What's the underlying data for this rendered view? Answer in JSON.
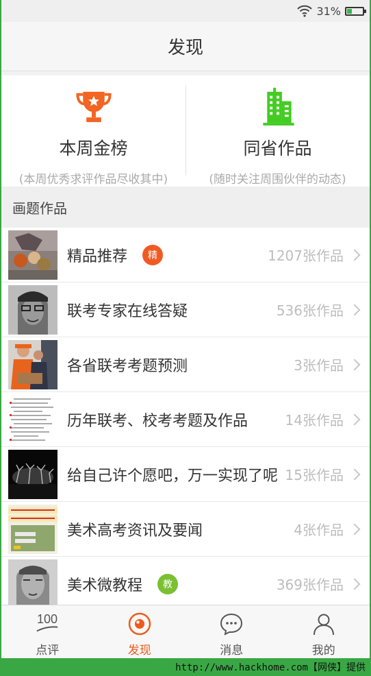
{
  "status_bar": {
    "battery_percent": "31%",
    "battery_level": 0.31,
    "wifi_icon": "wifi-icon"
  },
  "header": {
    "title": "发现"
  },
  "featured": [
    {
      "title": "本周金榜",
      "subtitle": "(本周优秀求评作品尽收其中)",
      "icon": "trophy-icon",
      "color": "#f26522"
    },
    {
      "title": "同省作品",
      "subtitle": "(随时关注周围伙伴的动态)",
      "icon": "buildings-icon",
      "color": "#44cc22"
    }
  ],
  "section": {
    "title": "画题作品"
  },
  "items": [
    {
      "label": "精品推荐",
      "badge": "精",
      "badge_color": "#f05a22",
      "count": "1207张作品"
    },
    {
      "label": "联考专家在线答疑",
      "count": "536张作品"
    },
    {
      "label": "各省联考考题预测",
      "count": "3张作品"
    },
    {
      "label": "历年联考、校考考题及作品",
      "count": "14张作品"
    },
    {
      "label": "给自己许个愿吧，万一实现了呢",
      "count": "15张作品"
    },
    {
      "label": "美术高考资讯及要闻",
      "count": "4张作品"
    },
    {
      "label": "美术微教程",
      "badge": "教",
      "badge_color": "#7bbf34",
      "count": "369张作品"
    }
  ],
  "tabs": [
    {
      "label": "点评",
      "icon": "review-100-icon",
      "glyph": "100"
    },
    {
      "label": "发现",
      "icon": "discover-icon",
      "active": true
    },
    {
      "label": "消息",
      "icon": "message-bubble-icon"
    },
    {
      "label": "我的",
      "icon": "person-icon"
    }
  ],
  "colors": {
    "accent": "#ef5a1c",
    "frame": "#39a844"
  },
  "watermark": "http://www.hackhome.com【网侠】提供"
}
